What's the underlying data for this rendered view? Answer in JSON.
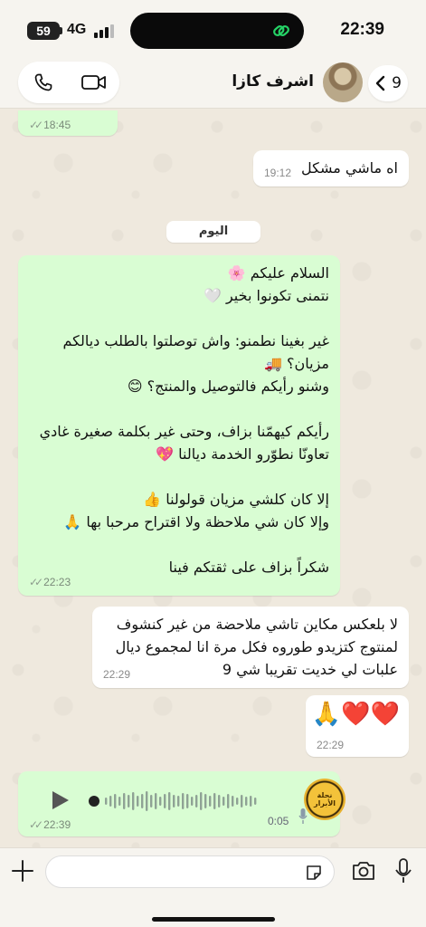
{
  "status_bar": {
    "battery": "59",
    "network": "4G",
    "time": "22:39"
  },
  "header": {
    "contact_name": "اشرف كازا",
    "back_count": "9",
    "icons": [
      "phone-icon",
      "video-call-icon",
      "chevron-left-icon"
    ]
  },
  "messages": [
    {
      "direction": "outgoing",
      "text": "",
      "time": "18:45",
      "read": true
    },
    {
      "direction": "incoming",
      "text": "اه ماشي مشكل",
      "time": "19:12"
    },
    {
      "direction": "day_separator",
      "text": "اليوم"
    },
    {
      "direction": "outgoing",
      "lines": [
        "السلام عليكم 🌸",
        "نتمنى تكونوا بخير 🤍",
        "",
        "غير بغينا نطمنو: واش توصلتوا بالطلب ديالكم",
        "مزيان؟ 🚚",
        "وشنو رأيكم فالتوصيل والمنتج؟ 😊",
        "",
        "رأيكم كيهمّنا بزاف، وحتى غير بكلمة صغيرة غادي",
        "تعاونّا نطوّرو الخدمة ديالنا 💖",
        "",
        "إلا كان كلشي مزيان قولولنا 👍",
        "وإلا كان شي ملاحظة ولا اقتراح مرحبا بها 🙏",
        "",
        "شكراً بزاف على ثقتكم فينا"
      ],
      "time": "22:23",
      "read": true
    },
    {
      "direction": "incoming",
      "lines": [
        "لا بلعكس مكاين تاشي ملاحضة من غير كنشوف",
        "لمنتوج كتزيدو طوروه فكل مرة انا لمجموع ديال",
        "علبات لي خديت تقريبا شي 9"
      ],
      "time": "22:29"
    },
    {
      "direction": "incoming",
      "text": "🙏❤️❤️",
      "time": "22:29"
    },
    {
      "direction": "outgoing",
      "type": "voice",
      "duration": "0:05",
      "time": "22:39",
      "read": true,
      "avatar_text": "نحلة الأبرار"
    }
  ],
  "composer": {
    "placeholder": "",
    "icons": [
      "plus-icon",
      "sticker-icon",
      "camera-icon",
      "microphone-icon"
    ]
  },
  "colors": {
    "outgoing_bubble": "#d9fdd3",
    "incoming_bubble": "#ffffff",
    "background": "#efe9de",
    "island_accent": "#25d366"
  }
}
